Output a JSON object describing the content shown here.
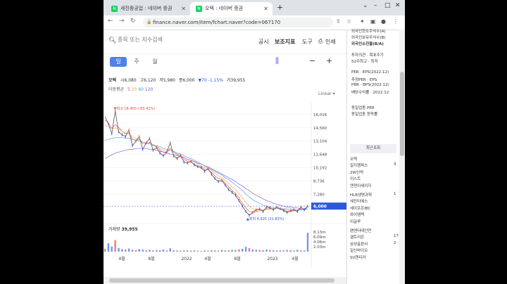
{
  "browser": {
    "tabs": [
      {
        "favicon": "N",
        "title": "세진중공업 : 네이버 증권",
        "active": false
      },
      {
        "favicon": "N",
        "title": "오텍 : 네이버 증권",
        "active": true
      }
    ],
    "new_tab": "+",
    "url": "finance.naver.com/item/fchart.naver?code=067170",
    "window_controls": {
      "chevron": "⌄",
      "minimize": "–",
      "maximize": "□",
      "close": "✕"
    }
  },
  "search": {
    "placeholder": "종목 또는 지수검색"
  },
  "menu": {
    "notice": "공시",
    "indicator": "보조지표",
    "tools": "도구",
    "print": "인쇄"
  },
  "periods": [
    "일",
    "주",
    "월"
  ],
  "stock": {
    "name": "오텍",
    "open_label": "시",
    "open": "6,080",
    "high_label": "고",
    "high": "6,120",
    "low_label": "저",
    "low": "5,980",
    "close_label": "종",
    "close": "6,000",
    "change": "▼70 -1.15%",
    "volume_label": "거",
    "volume": "39,955"
  },
  "ma_legend": {
    "label": "이동평균",
    "values": [
      "5",
      "20",
      "60",
      "120"
    ],
    "colors": [
      "#e8463c",
      "#e8a53c",
      "#3c9be8",
      "#7e4ee8"
    ]
  },
  "scale_mode": "Linear",
  "chart_data": {
    "type": "line",
    "title": "",
    "x_labels": [
      "4월",
      "8월",
      "2022",
      "4월",
      "8월",
      "2023",
      "4월"
    ],
    "price_ticks": [
      "16,016",
      "14,560",
      "13,104",
      "11,648",
      "10,192",
      "8,736",
      "7,280"
    ],
    "current_price": "6,000",
    "current_price_value": 6000,
    "high_label": "최고 16,400 (-63.41%)",
    "high_value": 16400,
    "low_label": "최저 4,925 (21.83%)",
    "low_value": 4925,
    "ylim": [
      4400,
      17000
    ],
    "volume_label": "거래량",
    "volume_value": "39,955",
    "volume_ticks": [
      "8.13m",
      "6.09m",
      "4.06m",
      "2.03m"
    ],
    "volume_max": 8.13,
    "price_series": [
      15800,
      15000,
      13900,
      16400,
      14100,
      13800,
      13600,
      14300,
      12600,
      13100,
      13600,
      12200,
      12900,
      13400,
      12100,
      12400,
      11800,
      11500,
      11900,
      12900,
      11500,
      11200,
      11500,
      10800,
      10700,
      10900,
      10500,
      10300,
      10200,
      9800,
      10100,
      9500,
      9000,
      8700,
      8800,
      8300,
      7800,
      7500,
      7200,
      6600,
      6000,
      5400,
      5000,
      5300,
      5600,
      5700,
      5400,
      5900,
      5800,
      5600,
      5900,
      5700,
      5500,
      5300,
      5500,
      5600,
      5400,
      5900,
      5600,
      6000
    ],
    "ma_series": [
      {
        "name": "5",
        "values": [
          15400,
          15100,
          14500,
          14900,
          14600,
          14200,
          13900,
          14000,
          13300,
          13200,
          13300,
          12800,
          12800,
          13000,
          12600,
          12500,
          12100,
          11900,
          11900,
          12300,
          11900,
          11600,
          11500,
          11100,
          10900,
          10800,
          10600,
          10400,
          10300,
          10000,
          10000,
          9700,
          9300,
          9000,
          8900,
          8500,
          8100,
          7700,
          7400,
          6900,
          6300,
          5800,
          5400,
          5300,
          5400,
          5500,
          5500,
          5700,
          5700,
          5700,
          5800,
          5700,
          5600,
          5400,
          5400,
          5500,
          5500,
          5700,
          5700,
          5900
        ]
      },
      {
        "name": "20",
        "values": [
          14800,
          14700,
          14500,
          14500,
          14400,
          14200,
          14000,
          13900,
          13600,
          13400,
          13300,
          13000,
          12900,
          12900,
          12700,
          12600,
          12300,
          12100,
          12000,
          12100,
          11900,
          11700,
          11600,
          11300,
          11100,
          11000,
          10800,
          10600,
          10400,
          10200,
          10100,
          9900,
          9600,
          9300,
          9100,
          8800,
          8500,
          8100,
          7800,
          7400,
          6900,
          6400,
          6000,
          5700,
          5600,
          5600,
          5600,
          5600,
          5700,
          5700,
          5700,
          5700,
          5700,
          5600,
          5500,
          5500,
          5500,
          5600,
          5600,
          5700
        ]
      },
      {
        "name": "60",
        "values": [
          13200,
          13300,
          13400,
          13500,
          13500,
          13500,
          13400,
          13400,
          13300,
          13200,
          13100,
          13000,
          12900,
          12800,
          12700,
          12600,
          12500,
          12300,
          12200,
          12100,
          12000,
          11800,
          11700,
          11500,
          11300,
          11200,
          11000,
          10800,
          10600,
          10400,
          10200,
          10000,
          9800,
          9600,
          9400,
          9100,
          8900,
          8600,
          8300,
          8000,
          7700,
          7300,
          7000,
          6700,
          6500,
          6300,
          6100,
          6000,
          5900,
          5800,
          5800,
          5700,
          5700,
          5700,
          5700,
          5600,
          5600,
          5600,
          5600,
          5700
        ]
      },
      {
        "name": "120",
        "values": [
          11200,
          11400,
          11600,
          11800,
          11900,
          12000,
          12100,
          12200,
          12200,
          12300,
          12300,
          12300,
          12300,
          12200,
          12200,
          12100,
          12000,
          11900,
          11800,
          11700,
          11600,
          11500,
          11400,
          11300,
          11100,
          11000,
          10900,
          10700,
          10600,
          10400,
          10300,
          10100,
          9900,
          9700,
          9500,
          9300,
          9100,
          8900,
          8700,
          8400,
          8200,
          7900,
          7700,
          7400,
          7200,
          7000,
          6800,
          6600,
          6500,
          6300,
          6200,
          6100,
          6000,
          5900,
          5900,
          5800,
          5800,
          5700,
          5700,
          5700
        ]
      }
    ],
    "volume_series": [
      1.2,
      3.5,
      2.1,
      4.8,
      1.5,
      1.0,
      0.9,
      1.3,
      0.8,
      0.7,
      1.1,
      0.9,
      0.6,
      0.8,
      0.5,
      0.7,
      0.6,
      0.9,
      0.5,
      1.4,
      0.6,
      0.5,
      0.4,
      0.5,
      0.6,
      0.4,
      0.5,
      0.4,
      0.3,
      0.5,
      0.4,
      0.6,
      0.5,
      0.4,
      0.7,
      0.5,
      0.6,
      0.8,
      0.7,
      1.0,
      1.2,
      2.0,
      1.5,
      0.9,
      0.8,
      0.7,
      0.6,
      0.9,
      0.7,
      0.6,
      0.5,
      0.6,
      0.5,
      0.7,
      0.6,
      0.5,
      0.8,
      0.6,
      0.5,
      7.8
    ]
  },
  "side_panel": {
    "top_lines": [
      "외국인한도주식수(A)",
      "외국인보유주식수(B)",
      "외국인소진율(B/A)"
    ],
    "mid_lines": [
      "투자의견 · 목표주가",
      "52주최고 · 최저"
    ],
    "ratio_lines": [
      "PER · EPS(2022.12)",
      "추정PER · EPS",
      "PBR · BPS(2022.12)",
      "배당수익률 · 2022.12"
    ],
    "industry_lines": [
      "동일업종 PER",
      "동일업종 등락률"
    ],
    "recent_tab": "최근조회",
    "recent_items": [
      {
        "name": "오텍",
        "num": ""
      },
      {
        "name": "일지캠퍼스",
        "num": "3"
      },
      {
        "name": "2W신약",
        "num": ""
      },
      {
        "name": "이스트",
        "num": ""
      },
      {
        "name": "엔젠이세이지",
        "num": ""
      },
      {
        "name": "HLB생명과학",
        "num": "1"
      },
      {
        "name": "세진티에스",
        "num": ""
      },
      {
        "name": "세이프온IBC",
        "num": ""
      },
      {
        "name": "와이엠텍",
        "num": ""
      },
      {
        "name": "이글루",
        "num": ""
      },
      {
        "name": "팬엔터테인먼",
        "num": ""
      },
      {
        "name": "셀트리온",
        "num": "17"
      },
      {
        "name": "삼성출판사",
        "num": "2"
      },
      {
        "name": "일신바이오",
        "num": ""
      },
      {
        "name": "SV헨티카",
        "num": ""
      }
    ]
  }
}
